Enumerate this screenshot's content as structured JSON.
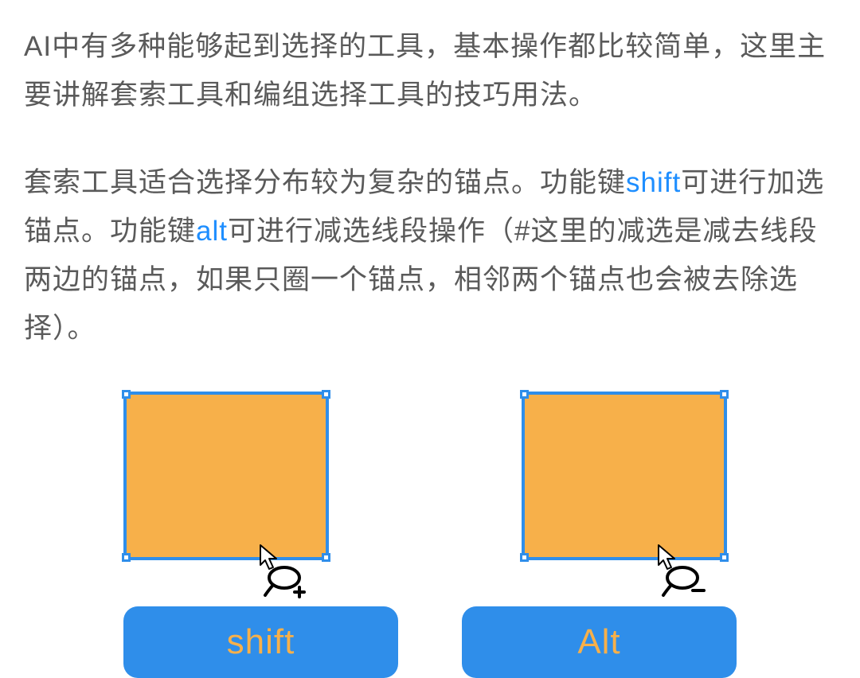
{
  "paragraphs": {
    "p1": "AI中有多种能够起到选择的工具，基本操作都比较简单，这里主要讲解套索工具和编组选择工具的技巧用法。",
    "p2_a": "套索工具适合选择分布较为复杂的锚点。功能键",
    "p2_shift": "shift",
    "p2_b": "可进行加选锚点。功能键",
    "p2_alt": "alt",
    "p2_c": "可进行减选线段操作（#这里的减选是减去线段两边的锚点，如果只圈一个锚点，相邻两个锚点也会被去除选择）。"
  },
  "buttons": {
    "shift": "shift",
    "alt": "Alt"
  },
  "colors": {
    "accent_blue": "#2f8eea",
    "accent_orange": "#f7b04a",
    "link_blue": "#1e8eff",
    "text_gray": "#5a5a5a"
  },
  "illustrations": {
    "left": {
      "cursor_type": "lasso-plus-icon"
    },
    "right": {
      "cursor_type": "lasso-minus-icon"
    }
  }
}
